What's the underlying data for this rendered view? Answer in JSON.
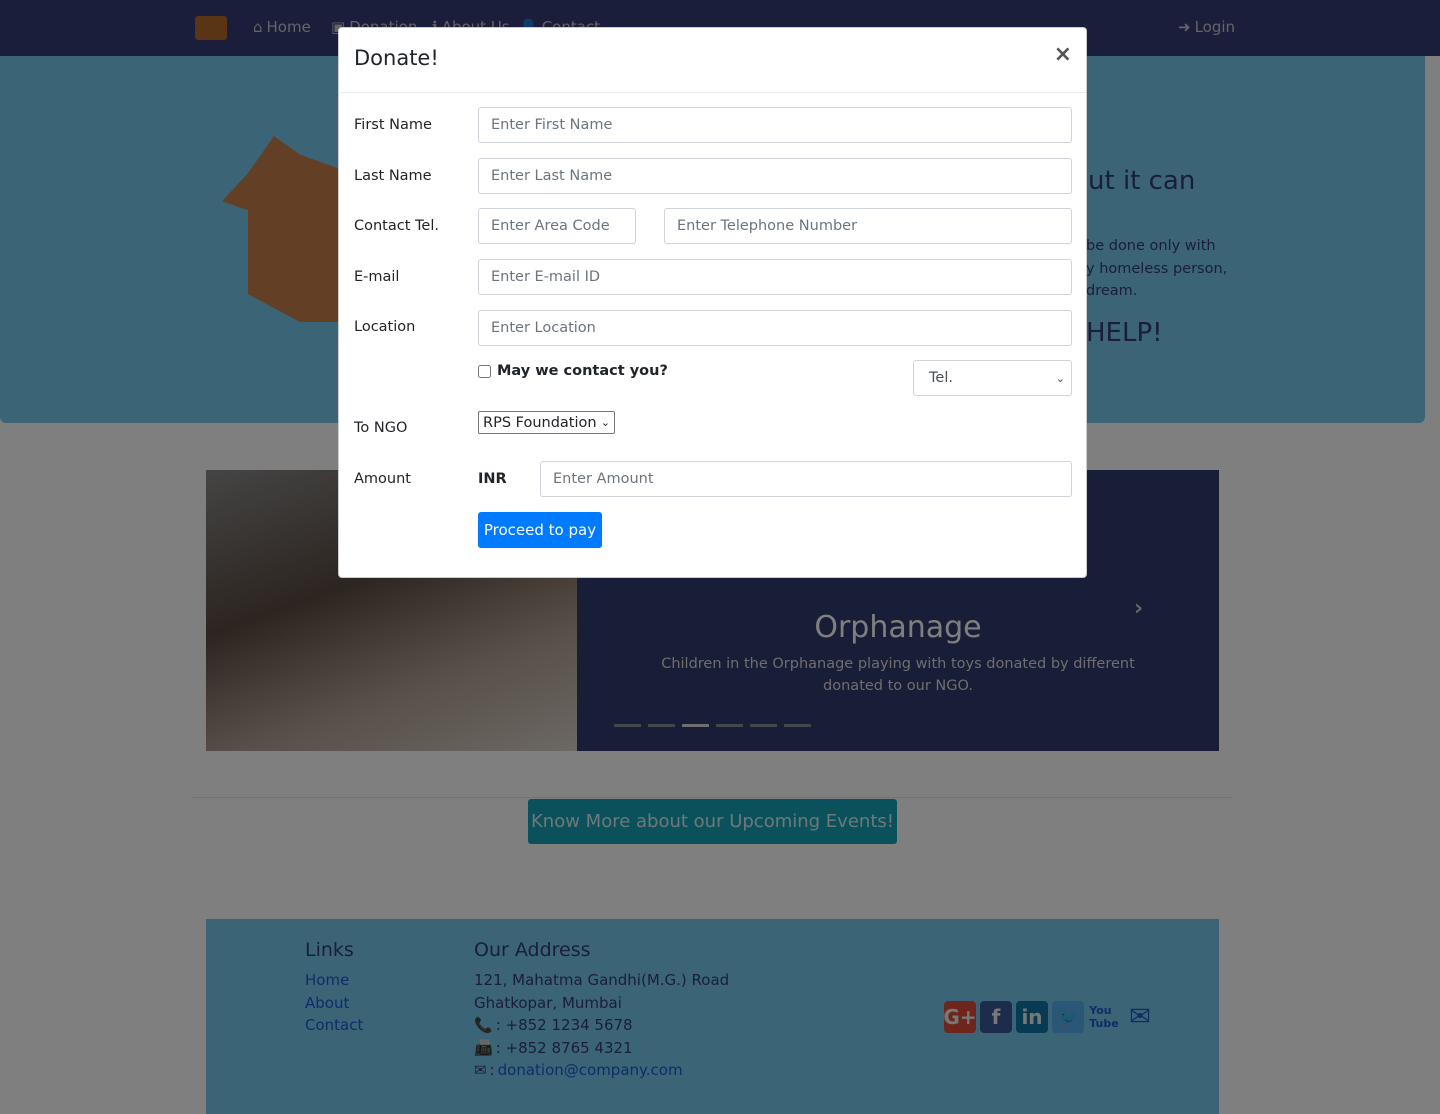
{
  "nav": {
    "home": "Home",
    "donation": "Donation",
    "about": "About Us",
    "contact": "Contact",
    "login": "Login"
  },
  "hero": {
    "heading_fragment": "ut it can",
    "line1": "be done only with",
    "line2": "y homeless person,",
    "line3": "dream.",
    "help": "HELP!"
  },
  "carousel": {
    "title": "Orphanage",
    "caption_line1": "Children in the Orphanage playing with toys donated by different",
    "caption_line2": "donated to our NGO.",
    "slides": 6,
    "active_slide": 3
  },
  "events_button": "Know More about our Upcoming Events!",
  "footer": {
    "links_title": "Links",
    "links": [
      "Home",
      "About",
      "Contact"
    ],
    "address_title": "Our Address",
    "address1": "121, Mahatma Gandhi(M.G.) Road",
    "address2": "Ghatkopar, Mumbai",
    "phone": ": +852 1234 5678",
    "fax": ": +852 8765 4321",
    "email_prefix": ":",
    "email": "donation@company.com",
    "social": [
      "google-plus-icon",
      "facebook-icon",
      "linkedin-icon",
      "twitter-icon",
      "youtube-icon",
      "envelope-icon"
    ]
  },
  "modal": {
    "title": "Donate!",
    "close": "×",
    "first_name": {
      "label": "First Name",
      "placeholder": "Enter First Name"
    },
    "last_name": {
      "label": "Last Name",
      "placeholder": "Enter Last Name"
    },
    "contact": {
      "label": "Contact Tel.",
      "area_placeholder": "Enter Area Code",
      "tel_placeholder": "Enter Telephone Number"
    },
    "email": {
      "label": "E-mail",
      "placeholder": "Enter E-mail ID"
    },
    "location": {
      "label": "Location",
      "placeholder": "Enter Location"
    },
    "may_contact": {
      "label": "May we contact you?",
      "checked": false,
      "method": "Tel."
    },
    "ngo": {
      "label": "To NGO",
      "value": "RPS Foundation"
    },
    "amount": {
      "label": "Amount",
      "currency": "INR",
      "placeholder": "Enter Amount"
    },
    "submit": "Proceed to pay"
  },
  "colors": {
    "primary": "#007bff",
    "info": "#17a2b8",
    "navbar": "#343c74",
    "hero": "#76caee"
  }
}
